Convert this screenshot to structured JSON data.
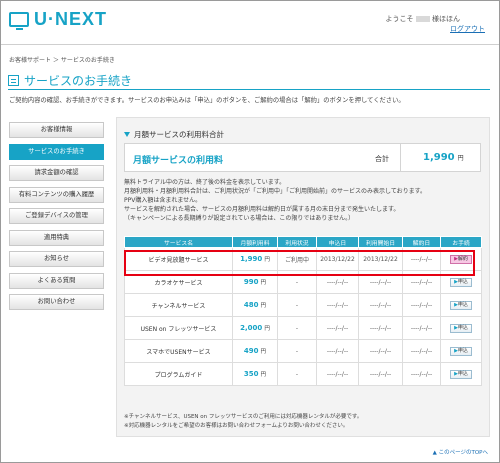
{
  "header": {
    "logo_text": "U·NEXT",
    "welcome_prefix": "ようこそ",
    "welcome_suffix": "様ほほん",
    "logout_label": "ログアウト"
  },
  "breadcrumb": "お客様サポート ＞ サービスのお手続き",
  "page_title": "サービスのお手続き",
  "intro": "ご契約内容の確認、お手続きができます。サービスのお申込みは「申込」のボタンを、ご解約の場合は「解約」のボタンを押してください。",
  "sidebar": {
    "items": [
      {
        "label": "お客様情報"
      },
      {
        "label": "サービスのお手続き"
      },
      {
        "label": "請求金額の確認"
      },
      {
        "label": "有料コンテンツの購入履歴"
      },
      {
        "label": "ご登録デバイスの管理"
      },
      {
        "label": "適用特典"
      },
      {
        "label": "お知らせ"
      },
      {
        "label": "よくある質問"
      },
      {
        "label": "お問い合わせ"
      }
    ]
  },
  "section_heading": "月額サービスの利用料合計",
  "summary": {
    "label": "月額サービスの利用料",
    "total_label": "合計",
    "total_value": "1,990",
    "total_unit": "円"
  },
  "notes": [
    "無料トライアル中の方は、終了後の料金を表示しています。",
    "月額利用料・月額利用料合計は、ご利用状況が「ご利用中」「ご利用開始前」のサービスのみ表示しております。",
    "PPV購入額は含まれません。",
    "サービスを解約された場合、サービスの月額利用料は解約日が属する月の末日分まで発生いたします。",
    "（キャンペーンによる長期縛りが設定されている場合は、この限りではありません。）"
  ],
  "table": {
    "headers": [
      "サービス名",
      "月額利用料",
      "利用状況",
      "申込日",
      "利用開始日",
      "解約日",
      "お手続"
    ],
    "rows": [
      {
        "service": "ビデオ見放題サービス",
        "fee": "1,990",
        "unit": "円",
        "status": "ご利用中",
        "apply_date": "2013/12/22",
        "start_date": "2013/12/22",
        "cancel_date": "----/--/--",
        "action": "解約",
        "action_type": "cancel"
      },
      {
        "service": "カラオケサービス",
        "fee": "990",
        "unit": "円",
        "status": "-",
        "apply_date": "----/--/--",
        "start_date": "----/--/--",
        "cancel_date": "----/--/--",
        "action": "申込",
        "action_type": "apply"
      },
      {
        "service": "チャンネルサービス",
        "fee": "480",
        "unit": "円",
        "status": "-",
        "apply_date": "----/--/--",
        "start_date": "----/--/--",
        "cancel_date": "----/--/--",
        "action": "申込",
        "action_type": "apply"
      },
      {
        "service": "USEN on フレッツサービス",
        "fee": "2,000",
        "unit": "円",
        "status": "-",
        "apply_date": "----/--/--",
        "start_date": "----/--/--",
        "cancel_date": "----/--/--",
        "action": "申込",
        "action_type": "apply"
      },
      {
        "service": "スマホでUSENサービス",
        "fee": "490",
        "unit": "円",
        "status": "-",
        "apply_date": "----/--/--",
        "start_date": "----/--/--",
        "cancel_date": "----/--/--",
        "action": "申込",
        "action_type": "apply"
      },
      {
        "service": "プログラムガイド",
        "fee": "350",
        "unit": "円",
        "status": "-",
        "apply_date": "----/--/--",
        "start_date": "----/--/--",
        "cancel_date": "----/--/--",
        "action": "申込",
        "action_type": "apply"
      }
    ]
  },
  "footnotes": [
    "※チャンネルサービス、USEN on フレッツサービスのご利用には対応機器レンタルが必要です。",
    "※対応機器レンタルをご希望のお客様はお問い合わせフォームよりお問い合わせください。"
  ],
  "page_top_label": "▲ このページのTOPへ",
  "colors": {
    "accent": "#17a3c6",
    "highlight": "#e60012",
    "cancel_button": "#f7c8e4"
  },
  "icons": {
    "logo": "tv-icon",
    "title": "list-icon",
    "section": "triangle-down-icon"
  }
}
